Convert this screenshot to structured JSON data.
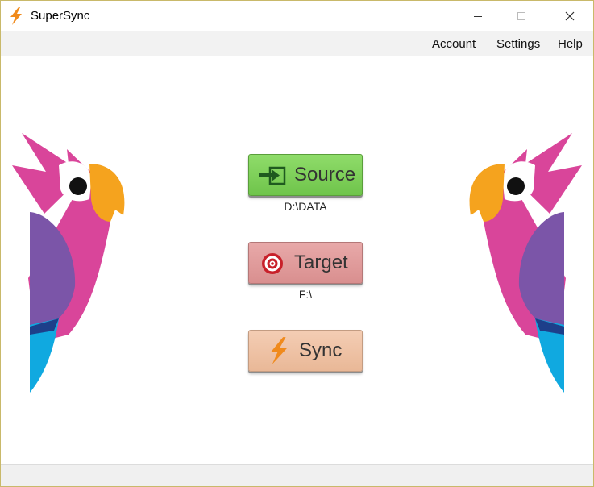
{
  "window": {
    "title": "SuperSync",
    "controls": {
      "minimize": "minimize",
      "maximize": "maximize",
      "close": "close"
    }
  },
  "menubar": {
    "items": [
      {
        "label": "Account"
      },
      {
        "label": "Settings"
      },
      {
        "label": "Help"
      }
    ]
  },
  "main": {
    "source_button": {
      "label": "Source",
      "icon": "enter-arrow-icon",
      "path": "D:\\DATA"
    },
    "target_button": {
      "label": "Target",
      "icon": "target-icon",
      "path": "F:\\"
    },
    "sync_button": {
      "label": "Sync",
      "icon": "lightning-icon"
    }
  },
  "colors": {
    "source_green": "#7ed159",
    "target_pink": "#e29c9c",
    "sync_peach": "#efc3a6",
    "parrot_pink": "#d9459a",
    "parrot_purple": "#7b55a8",
    "parrot_blue": "#10a9e0",
    "parrot_orange": "#f5a31e",
    "titlebar_border": "#c9b96a"
  }
}
